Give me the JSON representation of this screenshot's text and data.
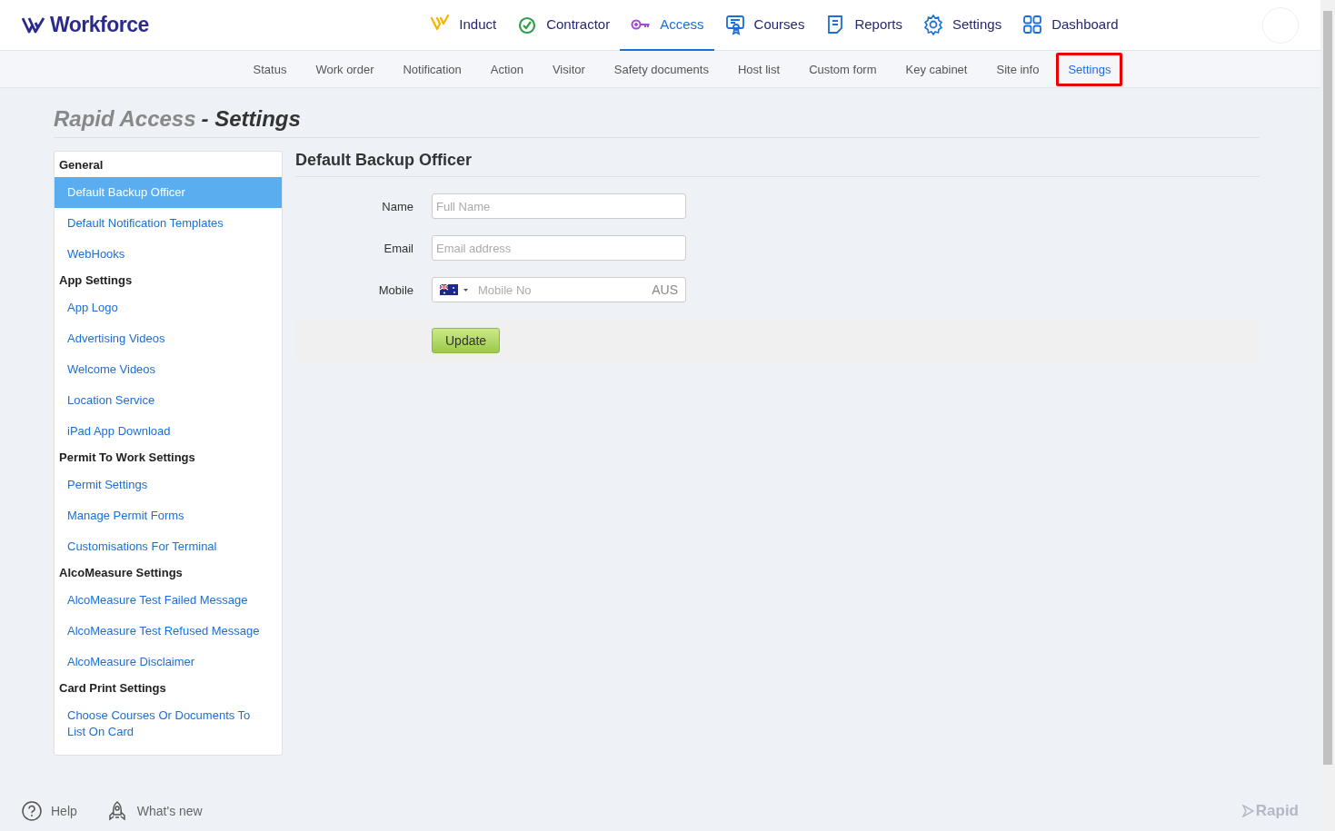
{
  "header": {
    "logo": "Workforce",
    "nav": [
      {
        "label": "Induct",
        "selected": false
      },
      {
        "label": "Contractor",
        "selected": false
      },
      {
        "label": "Access",
        "selected": true
      },
      {
        "label": "Courses",
        "selected": false
      },
      {
        "label": "Reports",
        "selected": false
      },
      {
        "label": "Settings",
        "selected": false
      },
      {
        "label": "Dashboard",
        "selected": false
      }
    ]
  },
  "subnav": [
    {
      "label": "Status",
      "selected": false
    },
    {
      "label": "Work order",
      "selected": false
    },
    {
      "label": "Notification",
      "selected": false
    },
    {
      "label": "Action",
      "selected": false
    },
    {
      "label": "Visitor",
      "selected": false
    },
    {
      "label": "Safety documents",
      "selected": false
    },
    {
      "label": "Host list",
      "selected": false
    },
    {
      "label": "Custom form",
      "selected": false
    },
    {
      "label": "Key cabinet",
      "selected": false
    },
    {
      "label": "Site info",
      "selected": false
    },
    {
      "label": "Settings",
      "selected": true
    }
  ],
  "page_title": {
    "module": "Rapid Access",
    "section": "- Settings"
  },
  "sidebar": [
    {
      "heading": "General",
      "items": [
        {
          "label": "Default Backup Officer",
          "selected": true
        },
        {
          "label": "Default Notification Templates",
          "selected": false
        },
        {
          "label": "WebHooks",
          "selected": false
        }
      ]
    },
    {
      "heading": "App Settings",
      "items": [
        {
          "label": "App Logo",
          "selected": false
        },
        {
          "label": "Advertising Videos",
          "selected": false
        },
        {
          "label": "Welcome Videos",
          "selected": false
        },
        {
          "label": "Location Service",
          "selected": false
        },
        {
          "label": "iPad App Download",
          "selected": false
        }
      ]
    },
    {
      "heading": "Permit To Work Settings",
      "items": [
        {
          "label": "Permit Settings",
          "selected": false
        },
        {
          "label": "Manage Permit Forms",
          "selected": false
        },
        {
          "label": "Customisations For Terminal",
          "selected": false
        }
      ]
    },
    {
      "heading": "AlcoMeasure Settings",
      "items": [
        {
          "label": "AlcoMeasure Test Failed Message",
          "selected": false
        },
        {
          "label": "AlcoMeasure Test Refused Message",
          "selected": false
        },
        {
          "label": "AlcoMeasure Disclaimer",
          "selected": false
        }
      ]
    },
    {
      "heading": "Card Print Settings",
      "items": [
        {
          "label": "Choose Courses Or Documents To List On Card",
          "selected": false
        }
      ]
    }
  ],
  "form": {
    "title": "Default Backup Officer",
    "fields": [
      {
        "kind": "text",
        "label": "Name",
        "placeholder": "Full Name"
      },
      {
        "kind": "text",
        "label": "Email",
        "placeholder": "Email address"
      },
      {
        "kind": "phone",
        "label": "Mobile",
        "placeholder": "Mobile No",
        "country": "AUS"
      }
    ],
    "submit": "Update"
  },
  "footer": {
    "help": "Help",
    "whats_new": "What's new",
    "brand": "Rapid"
  }
}
